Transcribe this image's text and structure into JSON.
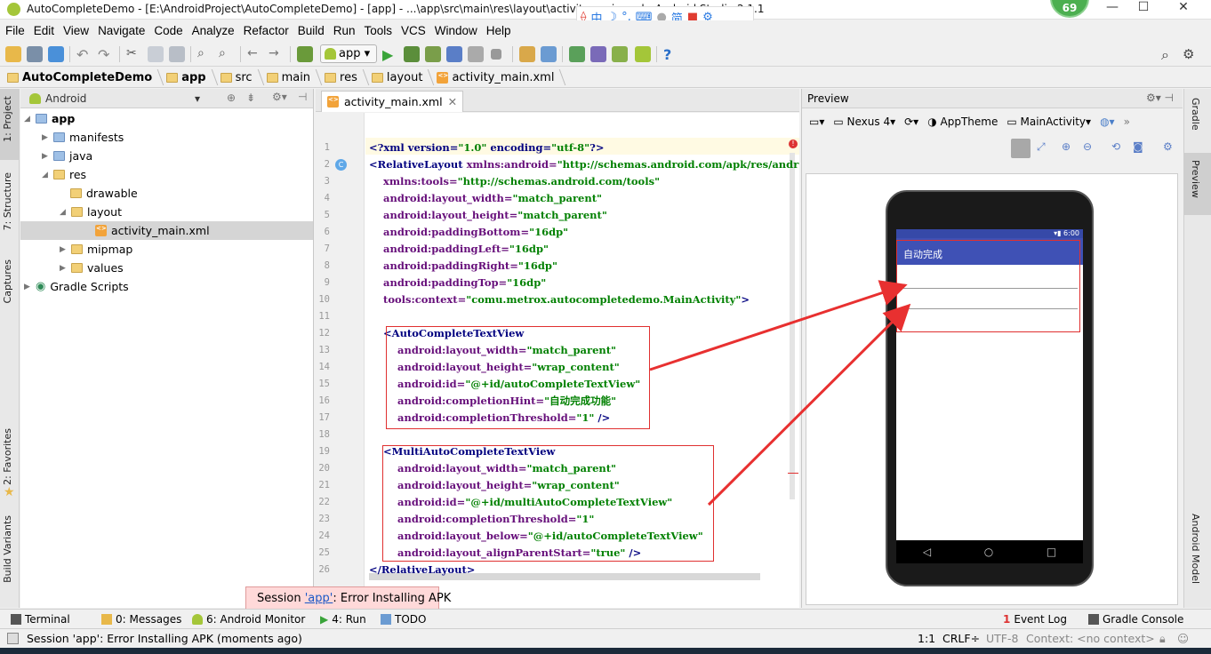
{
  "window": {
    "title": "AutoCompleteDemo - [E:\\AndroidProject\\AutoCompleteDemo] - [app] - ...\\app\\src\\main\\res\\layout\\activity_main.xml - Android Studio 2.1.1",
    "badge": "69",
    "ime": [
      "中",
      "简"
    ]
  },
  "menu": [
    "File",
    "Edit",
    "View",
    "Navigate",
    "Code",
    "Analyze",
    "Refactor",
    "Build",
    "Run",
    "Tools",
    "VCS",
    "Window",
    "Help"
  ],
  "toolbar": {
    "run_config": "app"
  },
  "breadcrumbs": [
    "AutoCompleteDemo",
    "app",
    "src",
    "main",
    "res",
    "layout",
    "activity_main.xml"
  ],
  "left_strip": [
    "1: Project",
    "7: Structure",
    "Captures",
    "2: Favorites",
    "Build Variants"
  ],
  "right_strip": [
    "Gradle",
    "Preview",
    "Android Model"
  ],
  "project": {
    "view": "Android",
    "tree": [
      {
        "label": "app",
        "bold": true
      },
      {
        "label": "manifests"
      },
      {
        "label": "java"
      },
      {
        "label": "res"
      },
      {
        "label": "drawable"
      },
      {
        "label": "layout"
      },
      {
        "label": "activity_main.xml",
        "selected": true
      },
      {
        "label": "mipmap"
      },
      {
        "label": "values"
      },
      {
        "label": "Gradle Scripts"
      }
    ]
  },
  "editor": {
    "tab": "activity_main.xml",
    "lines": [
      "1",
      "2",
      "3",
      "4",
      "5",
      "6",
      "7",
      "8",
      "9",
      "10",
      "11",
      "12",
      "13",
      "14",
      "15",
      "16",
      "17",
      "18",
      "19",
      "20",
      "21",
      "22",
      "23",
      "24",
      "25",
      "26"
    ],
    "code": [
      [
        [
          "t",
          "<?xml version="
        ],
        [
          "s",
          "\"1.0\""
        ],
        [
          "t",
          " encoding="
        ],
        [
          "s",
          "\"utf-8\""
        ],
        [
          "t",
          "?>"
        ]
      ],
      [
        [
          "t",
          "<RelativeLayout "
        ],
        [
          "a",
          "xmlns:android="
        ],
        [
          "s",
          "\"http://schemas.android.com/apk/res/andr"
        ]
      ],
      [
        [
          "t",
          "    "
        ],
        [
          "a",
          "xmlns:tools="
        ],
        [
          "s",
          "\"http://schemas.android.com/tools\""
        ]
      ],
      [
        [
          "t",
          "    "
        ],
        [
          "a",
          "android:layout_width="
        ],
        [
          "s",
          "\"match_parent\""
        ]
      ],
      [
        [
          "t",
          "    "
        ],
        [
          "a",
          "android:layout_height="
        ],
        [
          "s",
          "\"match_parent\""
        ]
      ],
      [
        [
          "t",
          "    "
        ],
        [
          "a",
          "android:paddingBottom="
        ],
        [
          "s",
          "\"16dp\""
        ]
      ],
      [
        [
          "t",
          "    "
        ],
        [
          "a",
          "android:paddingLeft="
        ],
        [
          "s",
          "\"16dp\""
        ]
      ],
      [
        [
          "t",
          "    "
        ],
        [
          "a",
          "android:paddingRight="
        ],
        [
          "s",
          "\"16dp\""
        ]
      ],
      [
        [
          "t",
          "    "
        ],
        [
          "a",
          "android:paddingTop="
        ],
        [
          "s",
          "\"16dp\""
        ]
      ],
      [
        [
          "t",
          "    "
        ],
        [
          "a",
          "tools:context="
        ],
        [
          "s",
          "\"comu.metrox.autocompletedemo.MainActivity\""
        ],
        [
          "t",
          ">"
        ]
      ],
      [
        [
          "t",
          ""
        ]
      ],
      [
        [
          "t",
          "    <AutoCompleteTextView"
        ]
      ],
      [
        [
          "t",
          "        "
        ],
        [
          "a",
          "android:layout_width="
        ],
        [
          "s",
          "\"match_parent\""
        ]
      ],
      [
        [
          "t",
          "        "
        ],
        [
          "a",
          "android:layout_height="
        ],
        [
          "s",
          "\"wrap_content\""
        ]
      ],
      [
        [
          "t",
          "        "
        ],
        [
          "a",
          "android:id="
        ],
        [
          "s",
          "\"@+id/autoCompleteTextView\""
        ]
      ],
      [
        [
          "t",
          "        "
        ],
        [
          "a",
          "android:completionHint="
        ],
        [
          "s",
          "\"自动完成功能\""
        ]
      ],
      [
        [
          "t",
          "        "
        ],
        [
          "a",
          "android:completionThreshold="
        ],
        [
          "s",
          "\"1\""
        ],
        [
          "t",
          " />"
        ]
      ],
      [
        [
          "t",
          ""
        ]
      ],
      [
        [
          "t",
          "    <MultiAutoCompleteTextView"
        ]
      ],
      [
        [
          "t",
          "        "
        ],
        [
          "a",
          "android:layout_width="
        ],
        [
          "s",
          "\"match_parent\""
        ]
      ],
      [
        [
          "t",
          "        "
        ],
        [
          "a",
          "android:layout_height="
        ],
        [
          "s",
          "\"wrap_content\""
        ]
      ],
      [
        [
          "t",
          "        "
        ],
        [
          "a",
          "android:id="
        ],
        [
          "s",
          "\"@+id/multiAutoCompleteTextView\""
        ]
      ],
      [
        [
          "t",
          "        "
        ],
        [
          "a",
          "android:completionThreshold="
        ],
        [
          "s",
          "\"1\""
        ]
      ],
      [
        [
          "t",
          "        "
        ],
        [
          "a",
          "android:layout_below="
        ],
        [
          "s",
          "\"@+id/autoCompleteTextView\""
        ]
      ],
      [
        [
          "t",
          "        "
        ],
        [
          "a",
          "android:layout_alignParentStart="
        ],
        [
          "s",
          "\"true\""
        ],
        [
          "t",
          " />"
        ]
      ],
      [
        [
          "t",
          "</RelativeLayout>"
        ]
      ]
    ]
  },
  "preview": {
    "title": "Preview",
    "device": "Nexus 4",
    "theme": "AppTheme",
    "activity": "MainActivity",
    "status_time": "6:00",
    "app_title": "自动完成"
  },
  "bottom_tools": {
    "terminal": "Terminal",
    "messages": "0: Messages",
    "monitor": "6: Android Monitor",
    "run": "4: Run",
    "todo": "TODO",
    "event_log": "Event Log",
    "gradle_console": "Gradle Console"
  },
  "error_tip": {
    "prefix": "Session ",
    "link": "'app'",
    "suffix": ": Error Installing APK"
  },
  "status": {
    "message": "Session 'app': Error Installing APK (moments ago)",
    "position": "1:1",
    "line_sep": "CRLF÷",
    "encoding": "UTF-8",
    "context": "Context: <no context>"
  }
}
